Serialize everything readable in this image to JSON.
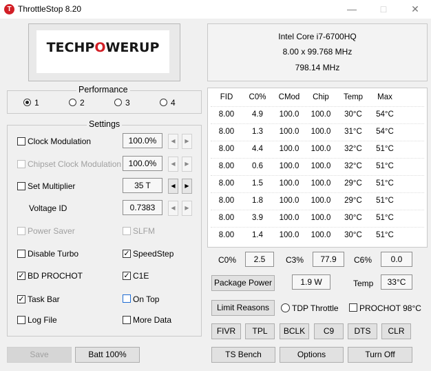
{
  "window": {
    "title": "ThrottleStop 8.20",
    "icon_letter": "T"
  },
  "logo": {
    "left": "TECHP",
    "o": "O",
    "right": "WERUP"
  },
  "cpu": {
    "name": "Intel Core i7-6700HQ",
    "multiplier": "8.00 x 99.768 MHz",
    "speed": "798.14 MHz"
  },
  "performance": {
    "title": "Performance",
    "options": [
      "1",
      "2",
      "3",
      "4"
    ],
    "selected": 0
  },
  "settings": {
    "title": "Settings",
    "clock_modulation": {
      "label": "Clock Modulation",
      "value": "100.0%"
    },
    "chipset_clock_modulation": {
      "label": "Chipset Clock Modulation",
      "value": "100.0%"
    },
    "set_multiplier": {
      "label": "Set Multiplier",
      "value": "35 T"
    },
    "voltage_id": {
      "label": "Voltage ID",
      "value": "0.7383"
    },
    "power_saver": {
      "label": "Power Saver"
    },
    "slfm": {
      "label": "SLFM"
    },
    "disable_turbo": {
      "label": "Disable Turbo"
    },
    "speedstep": {
      "label": "SpeedStep"
    },
    "bd_prochot": {
      "label": "BD PROCHOT"
    },
    "c1e": {
      "label": "C1E"
    },
    "task_bar": {
      "label": "Task Bar"
    },
    "on_top": {
      "label": "On Top"
    },
    "log_file": {
      "label": "Log File"
    },
    "more_data": {
      "label": "More Data"
    },
    "check": "✓"
  },
  "table": {
    "headers": [
      "FID",
      "C0%",
      "CMod",
      "Chip",
      "Temp",
      "Max"
    ],
    "rows": [
      [
        "8.00",
        "4.9",
        "100.0",
        "100.0",
        "30°C",
        "54°C"
      ],
      [
        "8.00",
        "1.3",
        "100.0",
        "100.0",
        "31°C",
        "54°C"
      ],
      [
        "8.00",
        "4.4",
        "100.0",
        "100.0",
        "32°C",
        "51°C"
      ],
      [
        "8.00",
        "0.6",
        "100.0",
        "100.0",
        "32°C",
        "51°C"
      ],
      [
        "8.00",
        "1.5",
        "100.0",
        "100.0",
        "29°C",
        "51°C"
      ],
      [
        "8.00",
        "1.8",
        "100.0",
        "100.0",
        "29°C",
        "51°C"
      ],
      [
        "8.00",
        "3.9",
        "100.0",
        "100.0",
        "30°C",
        "51°C"
      ],
      [
        "8.00",
        "1.4",
        "100.0",
        "100.0",
        "30°C",
        "51°C"
      ]
    ]
  },
  "stats": {
    "c0_label": "C0%",
    "c0_value": "2.5",
    "c3_label": "C3%",
    "c3_value": "77.9",
    "c6_label": "C6%",
    "c6_value": "0.0",
    "package_power_label": "Package Power",
    "package_power_value": "1.9 W",
    "temp_label": "Temp",
    "temp_value": "33°C",
    "limit_reasons_label": "Limit Reasons",
    "tdp_throttle_label": "TDP Throttle",
    "prochot_label": "PROCHOT 98°C"
  },
  "buttons": {
    "fivr": "FIVR",
    "tpl": "TPL",
    "bclk": "BCLK",
    "c9": "C9",
    "dts": "DTS",
    "clr": "CLR",
    "ts_bench": "TS Bench",
    "options": "Options",
    "turn_off": "Turn Off",
    "save": "Save",
    "batt": "Batt 100%"
  },
  "colors": {
    "accent_red": "#d21f26",
    "checkbox_focus": "#1c6bd3"
  }
}
